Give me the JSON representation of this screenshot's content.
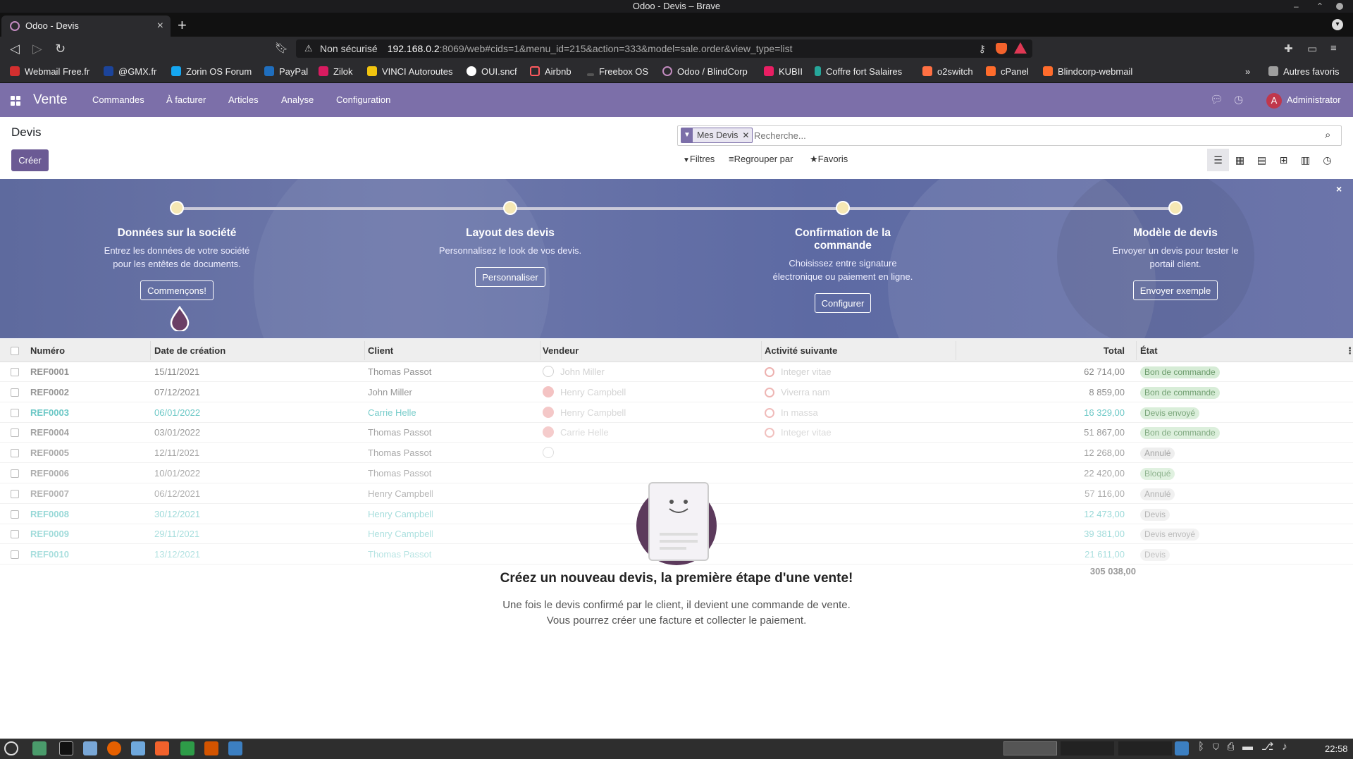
{
  "window": {
    "title": "Odoo - Devis – Brave"
  },
  "browser": {
    "tab_title": "Odoo - Devis",
    "tab_close": "×",
    "new_tab": "+",
    "security_label": "Non sécurisé",
    "url_host": "192.168.0.2",
    "url_rest": ":8069/web#cids=1&menu_id=215&action=333&model=sale.order&view_type=list",
    "bookmarks": [
      "Webmail Free.fr",
      "@GMX.fr",
      "Zorin OS Forum",
      "PayPal",
      "Zilok",
      "VINCI Autoroutes",
      "OUI.sncf",
      "Airbnb",
      "Freebox OS",
      "Odoo / BlindCorp",
      "KUBII",
      "Coffre fort Salaires",
      "o2switch",
      "cPanel",
      "Blindcorp-webmail"
    ],
    "bookmarks_more": "»",
    "other_bookmarks": "Autres favoris"
  },
  "odoo": {
    "app_name": "Vente",
    "menu": [
      "Commandes",
      "À facturer",
      "Articles",
      "Analyse",
      "Configuration"
    ],
    "user_initial": "A",
    "user_name": "Administrator"
  },
  "control": {
    "page_title": "Devis",
    "create_label": "Créer",
    "facet_label": "Mes Devis",
    "search_placeholder": "Recherche...",
    "filters_label": "Filtres",
    "groupby_label": "Regrouper par",
    "favorites_label": "Favoris"
  },
  "onboarding": {
    "steps": [
      {
        "title": "Données sur la société",
        "desc": "Entrez les données de votre société pour les entêtes de documents.",
        "button": "Commençons!"
      },
      {
        "title": "Layout des devis",
        "desc": "Personnalisez le look de vos devis.",
        "button": "Personnaliser"
      },
      {
        "title": "Confirmation de la commande",
        "desc": "Choisissez entre signature électronique ou paiement en ligne.",
        "button": "Configurer"
      },
      {
        "title": "Modèle de devis",
        "desc": "Envoyer un devis pour tester le portail client.",
        "button": "Envoyer exemple"
      }
    ],
    "close": "×"
  },
  "table": {
    "headers": {
      "number": "Numéro",
      "date": "Date de création",
      "client": "Client",
      "vendor": "Vendeur",
      "activity": "Activité suivante",
      "total": "Total",
      "state": "État"
    },
    "rows": [
      {
        "number": "REF0001",
        "date": "15/11/2021",
        "client": "Thomas Passot",
        "vendor": "John Miller",
        "activity": "Integer vitae",
        "total": "62 714,00",
        "state": "Bon de commande",
        "state_kind": "green",
        "highlight": false,
        "vendor_kind": "outline"
      },
      {
        "number": "REF0002",
        "date": "07/12/2021",
        "client": "John Miller",
        "vendor": "Henry Campbell",
        "activity": "Viverra nam",
        "total": "8 859,00",
        "state": "Bon de commande",
        "state_kind": "green",
        "highlight": false,
        "vendor_kind": "red"
      },
      {
        "number": "REF0003",
        "date": "06/01/2022",
        "client": "Carrie Helle",
        "vendor": "Henry Campbell",
        "activity": "In massa",
        "total": "16 329,00",
        "state": "Devis envoyé",
        "state_kind": "green",
        "highlight": true,
        "vendor_kind": "red"
      },
      {
        "number": "REF0004",
        "date": "03/01/2022",
        "client": "Thomas Passot",
        "vendor": "Carrie Helle",
        "activity": "Integer vitae",
        "total": "51 867,00",
        "state": "Bon de commande",
        "state_kind": "green",
        "highlight": false,
        "vendor_kind": "red"
      },
      {
        "number": "REF0005",
        "date": "12/11/2021",
        "client": "Thomas Passot",
        "vendor": "",
        "activity": "",
        "total": "12 268,00",
        "state": "Annulé",
        "state_kind": "grey",
        "highlight": false,
        "vendor_kind": "faint"
      },
      {
        "number": "REF0006",
        "date": "10/01/2022",
        "client": "Thomas Passot",
        "vendor": "",
        "activity": "",
        "total": "22 420,00",
        "state": "Bloqué",
        "state_kind": "green",
        "highlight": false,
        "vendor_kind": "none"
      },
      {
        "number": "REF0007",
        "date": "06/12/2021",
        "client": "Henry Campbell",
        "vendor": "",
        "activity": "",
        "total": "57 116,00",
        "state": "Annulé",
        "state_kind": "grey",
        "highlight": false,
        "vendor_kind": "none"
      },
      {
        "number": "REF0008",
        "date": "30/12/2021",
        "client": "Henry Campbell",
        "vendor": "",
        "activity": "",
        "total": "12 473,00",
        "state": "Devis",
        "state_kind": "grey",
        "highlight": true,
        "vendor_kind": "none"
      },
      {
        "number": "REF0009",
        "date": "29/11/2021",
        "client": "Henry Campbell",
        "vendor": "",
        "activity": "",
        "total": "39 381,00",
        "state": "Devis envoyé",
        "state_kind": "grey",
        "highlight": true,
        "vendor_kind": "none"
      },
      {
        "number": "REF0010",
        "date": "13/12/2021",
        "client": "Thomas Passot",
        "vendor": "",
        "activity": "",
        "total": "21 611,00",
        "state": "Devis",
        "state_kind": "grey",
        "highlight": true,
        "vendor_kind": "none"
      }
    ],
    "grand_total": "305 038,00"
  },
  "helper": {
    "title": "Créez un nouveau devis, la première étape d'une vente!",
    "line1": "Une fois le devis confirmé par le client, il devient une commande de vente.",
    "line2": "Vous pourrez créer une facture et collecter le paiement."
  },
  "taskbar": {
    "clock": "22:58"
  },
  "colors": {
    "odoo_purple": "#7c6fa9",
    "button_purple": "#6b5a94",
    "link_blue": "#00a09d",
    "badge_green": "#c9e6c9"
  }
}
